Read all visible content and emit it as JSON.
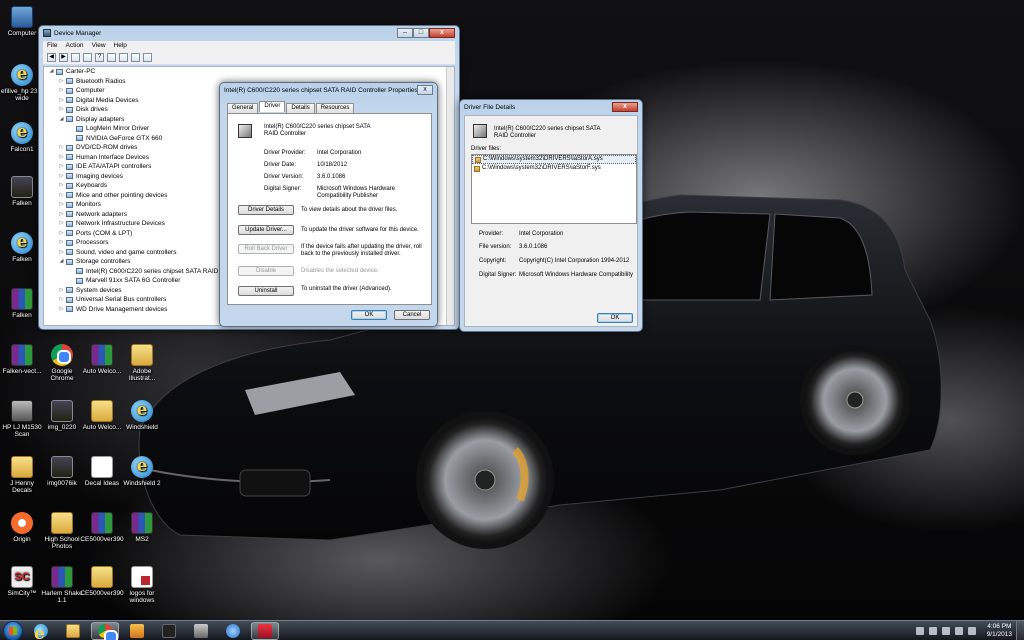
{
  "desktop": {
    "icons": [
      {
        "label": "Computer",
        "icon": "computer-icon"
      },
      {
        "label": "efilive_hp 23.1 wide",
        "icon": "ie-shortcut-icon"
      },
      {
        "label": "Falcon1",
        "icon": "ie-shortcut-icon"
      },
      {
        "label": "Falken",
        "icon": "image-icon"
      },
      {
        "label": "Falken",
        "icon": "ie-shortcut-icon"
      },
      {
        "label": "Falken",
        "icon": "winrar-icon"
      },
      {
        "label": "Falken-vect...",
        "icon": "winrar-icon"
      },
      {
        "label": "Google Chrome",
        "icon": "chrome-icon"
      },
      {
        "label": "Auto Welco...",
        "icon": "winrar-icon"
      },
      {
        "label": "Adobe Illustrat...",
        "icon": "folder-icon"
      },
      {
        "label": "HP LJ M1530 Scan",
        "icon": "scanner-icon"
      },
      {
        "label": "img_0220",
        "icon": "image-icon"
      },
      {
        "label": "Auto Welco...",
        "icon": "folder-icon"
      },
      {
        "label": "Windshield",
        "icon": "ie-shortcut-icon"
      },
      {
        "label": "J Henny Decals",
        "icon": "folder-icon"
      },
      {
        "label": "img0076ik",
        "icon": "image-icon"
      },
      {
        "label": "Decal Ideas",
        "icon": "document-icon"
      },
      {
        "label": "Windshield 2",
        "icon": "ie-shortcut-icon"
      },
      {
        "label": "Origin",
        "icon": "origin-icon"
      },
      {
        "label": "High School Photos",
        "icon": "folder-icon"
      },
      {
        "label": "CE5000ver390",
        "icon": "winrar-icon"
      },
      {
        "label": "MS2",
        "icon": "winrar-icon"
      },
      {
        "label": "SimCity™",
        "icon": "simcity-icon"
      },
      {
        "label": "Harlem Shake 1.1",
        "icon": "winrar-icon"
      },
      {
        "label": "CE5000ver390",
        "icon": "folder-icon"
      },
      {
        "label": "logos for windows",
        "icon": "pdf-icon"
      }
    ]
  },
  "device_manager": {
    "title": "Device Manager",
    "menu": [
      "File",
      "Action",
      "View",
      "Help"
    ],
    "tree": [
      {
        "label": "Carter-PC",
        "level": 0,
        "expander": "◢"
      },
      {
        "label": "Bluetooth Radios",
        "level": 1,
        "expander": "▷"
      },
      {
        "label": "Computer",
        "level": 1,
        "expander": "▷"
      },
      {
        "label": "Digital Media Devices",
        "level": 1,
        "expander": "▷"
      },
      {
        "label": "Disk drives",
        "level": 1,
        "expander": "▷"
      },
      {
        "label": "Display adapters",
        "level": 1,
        "expander": "◢"
      },
      {
        "label": "LogMeIn Mirror Driver",
        "level": 2,
        "expander": ""
      },
      {
        "label": "NVIDIA GeForce GTX 660",
        "level": 2,
        "expander": ""
      },
      {
        "label": "DVD/CD-ROM drives",
        "level": 1,
        "expander": "▷"
      },
      {
        "label": "Human Interface Devices",
        "level": 1,
        "expander": "▷"
      },
      {
        "label": "IDE ATA/ATAPI controllers",
        "level": 1,
        "expander": "▷"
      },
      {
        "label": "Imaging devices",
        "level": 1,
        "expander": "▷"
      },
      {
        "label": "Keyboards",
        "level": 1,
        "expander": "▷"
      },
      {
        "label": "Mice and other pointing devices",
        "level": 1,
        "expander": "▷"
      },
      {
        "label": "Monitors",
        "level": 1,
        "expander": "▷"
      },
      {
        "label": "Network adapters",
        "level": 1,
        "expander": "▷"
      },
      {
        "label": "Network Infrastructure Devices",
        "level": 1,
        "expander": "▷"
      },
      {
        "label": "Ports (COM & LPT)",
        "level": 1,
        "expander": "▷"
      },
      {
        "label": "Processors",
        "level": 1,
        "expander": "▷"
      },
      {
        "label": "Sound, video and game controllers",
        "level": 1,
        "expander": "▷"
      },
      {
        "label": "Storage controllers",
        "level": 1,
        "expander": "◢"
      },
      {
        "label": "Intel(R) C600/C220 series chipset SATA RAID Controller",
        "level": 2,
        "expander": ""
      },
      {
        "label": "Marvell 91xx SATA 6G Controller",
        "level": 2,
        "expander": ""
      },
      {
        "label": "System devices",
        "level": 1,
        "expander": "▷"
      },
      {
        "label": "Universal Serial Bus controllers",
        "level": 1,
        "expander": "▷"
      },
      {
        "label": "WD Drive Management devices",
        "level": 1,
        "expander": "▷"
      }
    ]
  },
  "properties": {
    "title": "Intel(R) C600/C220 series chipset SATA RAID Controller Properties",
    "tabs": [
      "General",
      "Driver",
      "Details",
      "Resources"
    ],
    "device_name": "Intel(R) C600/C220 series chipset SATA RAID Controller",
    "provider_label": "Driver Provider:",
    "provider": "Intel Corporation",
    "date_label": "Driver Date:",
    "date": "10/18/2012",
    "version_label": "Driver Version:",
    "version": "3.6.0.1086",
    "signer_label": "Digital Signer:",
    "signer": "Microsoft Windows Hardware Compatibility Publisher",
    "buttons": {
      "details": "Driver Details",
      "details_desc": "To view details about the driver files.",
      "update": "Update Driver...",
      "update_desc": "To update the driver software for this device.",
      "rollback": "Roll Back Driver",
      "rollback_desc": "If the device fails after updating the driver, roll back to the previously installed driver.",
      "disable": "Disable",
      "disable_desc": "Disables the selected device.",
      "uninstall": "Uninstall",
      "uninstall_desc": "To uninstall the driver (Advanced).",
      "ok": "OK",
      "cancel": "Cancel"
    }
  },
  "file_details": {
    "title": "Driver File Details",
    "device_name": "Intel(R) C600/C220 series chipset SATA RAID Controller",
    "files_label": "Driver files:",
    "files": [
      "C:\\Windows\\system32\\DRIVERS\\iaStorA.sys",
      "C:\\Windows\\system32\\DRIVERS\\iaStorF.sys"
    ],
    "provider_label": "Provider:",
    "provider": "Intel Corporation",
    "file_version_label": "File version:",
    "file_version": "3.6.0.1086",
    "copyright_label": "Copyright:",
    "copyright": "Copyright(C) Intel Corporation 1994-2012",
    "signer_label": "Digital Signer:",
    "signer": "Microsoft Windows Hardware Compatibility",
    "ok": "OK"
  },
  "taskbar": {
    "time": "4:06 PM",
    "date": "9/1/2013"
  }
}
